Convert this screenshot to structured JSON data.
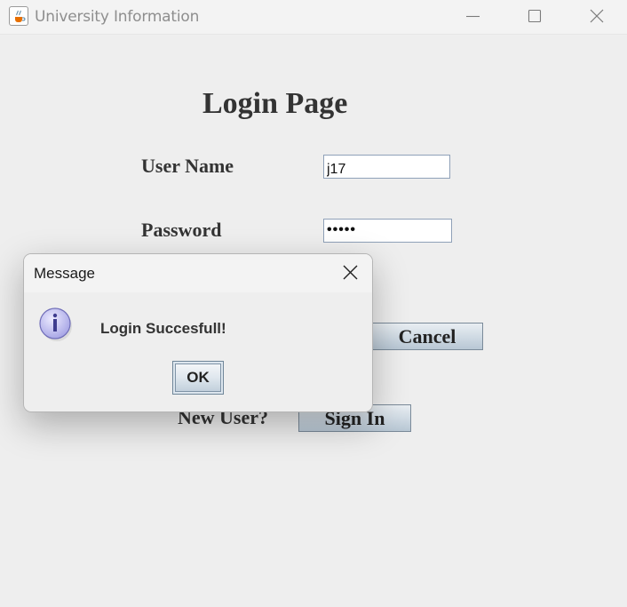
{
  "window": {
    "title": "University Information",
    "icon": "java-cup-icon",
    "controls": [
      "minimize",
      "maximize",
      "close"
    ]
  },
  "login": {
    "heading": "Login Page",
    "username_label": "User Name",
    "username_value": "j17",
    "password_label": "Password",
    "password_masked": "•••••",
    "cancel_label": "Cancel",
    "new_user_label": "New User?",
    "signin_label": "Sign In"
  },
  "dialog": {
    "title": "Message",
    "message": "Login Succesfull!",
    "ok_label": "OK",
    "icon": "information-icon"
  },
  "colors": {
    "window_bg": "#eeeeee",
    "label_text": "#333333",
    "button_gradient_top": "#e9eef2",
    "button_gradient_bottom": "#b8c7d4",
    "info_icon": "#b9b8ef"
  }
}
